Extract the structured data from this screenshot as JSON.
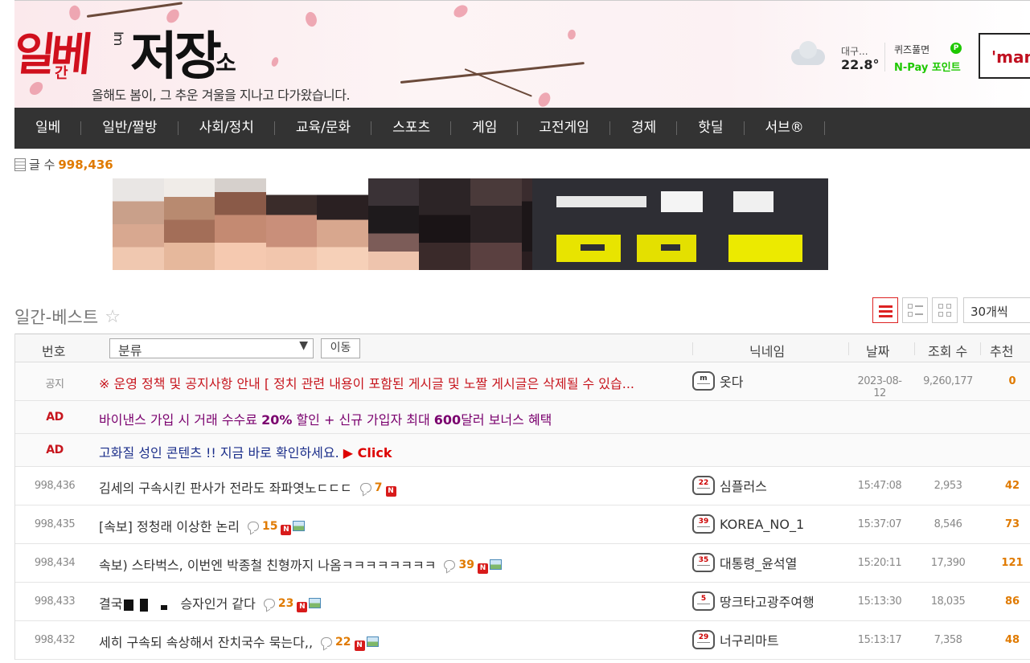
{
  "header": {
    "logo_red": "일베",
    "logo_sub": "간",
    "logo_mid": "Im",
    "logo_black": "저장",
    "logo_small": "소",
    "tagline": "올해도 봄이, 그 추운 겨울을 지나고 다가왔습니다.",
    "weather": {
      "city": "대구...",
      "temp": "22.8°"
    },
    "quiz": {
      "label": "퀴즈풀면",
      "pay": "N-Pay 포인트",
      "badge": "P"
    },
    "partner_box": "'man"
  },
  "nav": [
    "일베",
    "일반/짤방",
    "사회/정치",
    "교육/문화",
    "스포츠",
    "게임",
    "고전게임",
    "경제",
    "핫딜",
    "서브®"
  ],
  "post_count": {
    "label": "글 수",
    "value": "998,436"
  },
  "section": {
    "title": "일간-베스트",
    "per_page": "30개씩"
  },
  "table": {
    "headers": {
      "no": "번호",
      "category": "분류",
      "move": "이동",
      "nick": "닉네임",
      "date": "날짜",
      "views": "조회 수",
      "rec": "추천"
    },
    "notice": {
      "no": "공지",
      "title": "※ 운영 정책 및 공지사항 안내 [ 정치 관련 내용이 포함된 게시글 및 노짤 게시글은 삭제될 수 있습...",
      "level": "m",
      "nick": "옷다",
      "date": "2023-08-12",
      "views": "9,260,177",
      "rec": "0"
    },
    "ads": [
      {
        "label": "AD",
        "pre": "바이낸스 가입 시 거래 수수료 ",
        "b1": "20%",
        "mid": " 할인 + 신규 가입자 최대 ",
        "b2": "600",
        "post": "달러 보너스 혜택"
      },
      {
        "label": "AD",
        "pre": "고화질 성인 콘텐츠 !! 지금 바로 확인하세요. ",
        "click": "▶ Click"
      }
    ],
    "posts": [
      {
        "no": "998,436",
        "title": "김세의 구속시킨 판사가 전라도 좌파엿노ㄷㄷㄷ",
        "comments": "7",
        "img": false,
        "level": "22",
        "nick": "심플러스",
        "date": "15:47:08",
        "views": "2,953",
        "rec": "42"
      },
      {
        "no": "998,435",
        "title": "[속보] 정청래 이상한 논리",
        "comments": "15",
        "img": true,
        "level": "39",
        "nick": "KOREA_NO_1",
        "date": "15:37:07",
        "views": "8,546",
        "rec": "73"
      },
      {
        "no": "998,434",
        "title": "속보) 스타벅스, 이번엔 박종철 친형까지 나옴ㅋㅋㅋㅋㅋㅋㅋㅋ",
        "comments": "39",
        "img": true,
        "level": "35",
        "nick": "대통령_윤석열",
        "date": "15:20:11",
        "views": "17,390",
        "rec": "121"
      },
      {
        "no": "998,433",
        "title_pre": "결국",
        "title_post": "승자인거 같다",
        "comments": "23",
        "img": true,
        "level": "5",
        "nick": "땅크타고광주여행",
        "date": "15:13:30",
        "views": "18,035",
        "rec": "86"
      },
      {
        "no": "998,432",
        "title": "세히 구속되 속상해서 잔치국수 묵는다,,",
        "comments": "22",
        "img": true,
        "level": "29",
        "nick": "너구리마트",
        "date": "15:13:17",
        "views": "7,358",
        "rec": "48"
      }
    ]
  },
  "colors": {
    "nav_bg": "#333333",
    "accent_red": "#c7161e",
    "count_orange": "#e07a00",
    "npay_green": "#1ec800"
  }
}
